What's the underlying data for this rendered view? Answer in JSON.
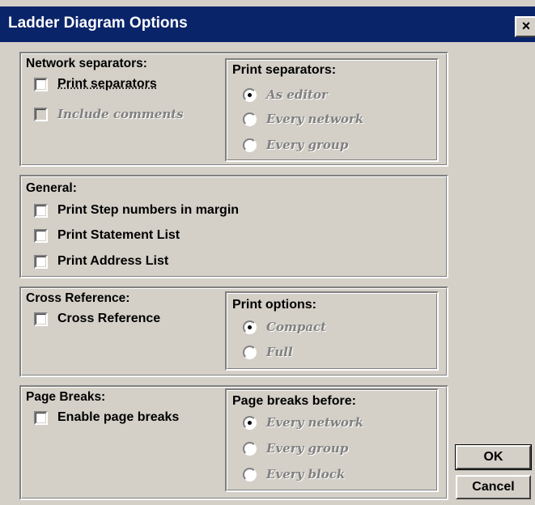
{
  "window": {
    "title": "Ladder Diagram Options",
    "close_symbol": "×"
  },
  "network": {
    "heading": "Network separators:",
    "print_separators": "Print separators",
    "include_comments": "Include comments",
    "print_group": {
      "heading": "Print separators:",
      "options": [
        "As editor",
        "Every network",
        "Every group"
      ],
      "selected": "As editor"
    }
  },
  "general": {
    "heading": "General:",
    "options": [
      "Print Step numbers in margin",
      "Print Statement List",
      "Print Address List"
    ]
  },
  "cross_reference": {
    "heading": "Cross Reference:",
    "checkbox": "Cross Reference",
    "print_group": {
      "heading": "Print options:",
      "options": [
        "Compact",
        "Full"
      ],
      "selected": "Compact"
    }
  },
  "page_breaks": {
    "heading": "Page Breaks:",
    "checkbox": "Enable page breaks",
    "before_group": {
      "heading": "Page breaks before:",
      "options": [
        "Every network",
        "Every group",
        "Every block"
      ],
      "selected": "Every network"
    }
  },
  "buttons": {
    "ok": "OK",
    "cancel": "Cancel"
  }
}
